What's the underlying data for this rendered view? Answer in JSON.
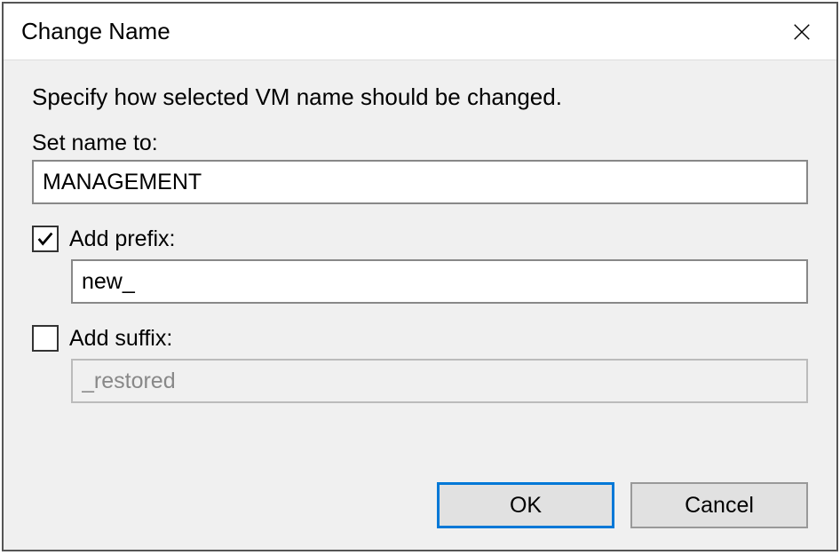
{
  "dialog": {
    "title": "Change Name",
    "instruction": "Specify how selected VM name should be changed.",
    "set_name_label": "Set name to:",
    "set_name_value": "MANAGEMENT",
    "add_prefix_label": "Add prefix:",
    "add_prefix_checked": true,
    "prefix_value": "new_",
    "add_suffix_label": "Add suffix:",
    "add_suffix_checked": false,
    "suffix_value": "_restored",
    "ok_label": "OK",
    "cancel_label": "Cancel"
  }
}
